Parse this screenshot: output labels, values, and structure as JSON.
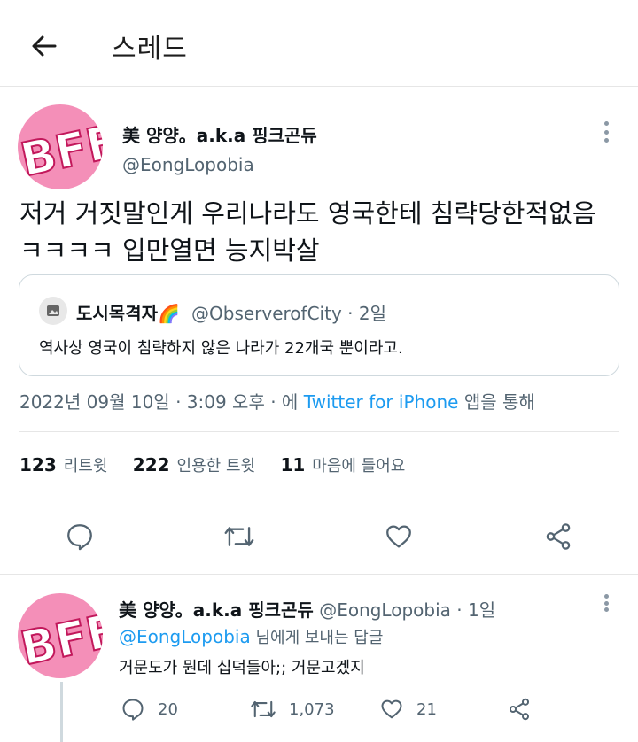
{
  "header": {
    "title": "스레드"
  },
  "main_tweet": {
    "display_name": "美 양양。a.k.a 핑크곤듀",
    "handle": "@EongLopobia",
    "text_line1": "저거 거짓말인게 우리나라도 영국한테 침략당한적없음",
    "text_line2": "ㅋㅋㅋㅋ 입만열면 능지박살",
    "quote": {
      "display_name": "도시목격자🌈",
      "handle": "@ObserverofCity · 2일",
      "text": "역사상 영국이 침략하지 않은 나라가 22개국 뿐이라고."
    },
    "timestamp": "2022년 09월 10일 · 3:09 오후 · 에",
    "source": "Twitter for iPhone",
    "source_suffix": "앱을 통해",
    "stats": {
      "retweets": "123",
      "retweets_label": "리트윗",
      "quotes": "222",
      "quotes_label": "인용한 트윗",
      "likes": "11",
      "likes_label": "마음에 들어요"
    }
  },
  "reply": {
    "display_name": "美 양양。a.k.a 핑크곤듀",
    "meta": "@EongLopobia · 1일",
    "reply_to_handle": "@EongLopobia",
    "reply_to_suffix": "님에게 보내는 답글",
    "text": "거문도가 뭔데 십덕들아;; 거문고겠지",
    "replies": "20",
    "retweets": "1,073",
    "likes": "21"
  },
  "icons": {
    "back": "arrow-left-icon",
    "more": "more-vertical-icon",
    "reply": "comment-icon",
    "retweet": "retweet-icon",
    "like": "heart-icon",
    "share": "share-icon"
  },
  "colors": {
    "link": "#1d9bf0",
    "secondary_text": "#536471",
    "avatar_pink": "#f48fb8"
  }
}
